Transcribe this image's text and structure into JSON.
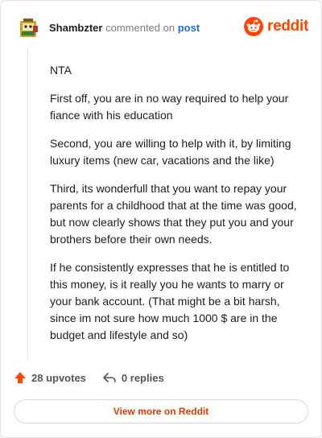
{
  "header": {
    "username": "Shambzter",
    "action_text": "commented on",
    "post_link": "post",
    "logo_text": "reddit"
  },
  "comment": {
    "paragraphs": [
      "NTA",
      "First off, you are in no way required to help your fiance with his education",
      "Second, you are willing to help with it, by limiting luxury items (new car, vacations and the like)",
      "Third, its wonderfull that you want to repay your parents for a childhood that at the time was good, but now clearly shows that they put you and your brothers before their own needs.",
      "If he consistently expresses that he is entitled to this money, is it really you he wants to marry or your bank account. (That might be a bit harsh, since im not sure how much 1000 $ are in the budget and lifestyle and so)"
    ]
  },
  "actions": {
    "upvotes_label": "28 upvotes",
    "replies_label": "0 replies"
  },
  "footer": {
    "view_more_label": "View more on Reddit"
  },
  "colors": {
    "brand": "#ff4500",
    "link": "#1d6fd6",
    "view_more_text": "#d93a00"
  },
  "icons": {
    "avatar": "snoo-avatar",
    "logo": "reddit-snoo-icon",
    "upvote": "upvote-arrow-icon",
    "reply": "reply-arrow-icon"
  }
}
